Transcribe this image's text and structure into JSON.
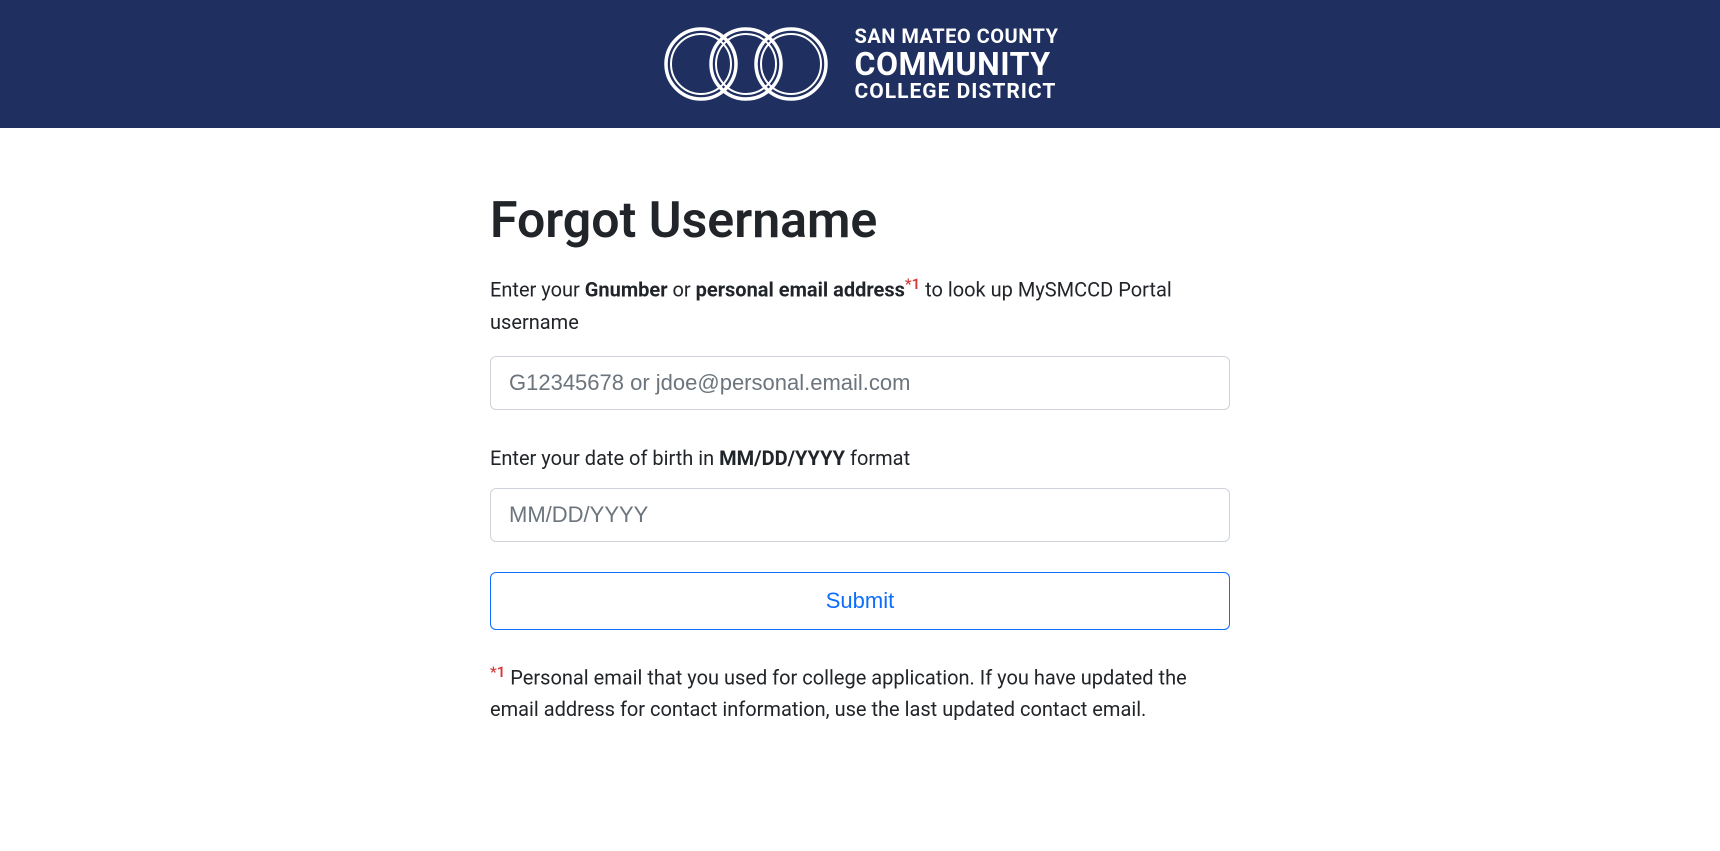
{
  "header": {
    "logo_line1": "SAN MATEO COUNTY",
    "logo_line2": "COMMUNITY",
    "logo_line3": "COLLEGE DISTRICT"
  },
  "page": {
    "title": "Forgot Username",
    "instruction_pre": "Enter your ",
    "instruction_bold1": "Gnumber",
    "instruction_mid": " or ",
    "instruction_bold2": "personal email address",
    "instruction_marker": "*1",
    "instruction_post": " to look up MySMCCD Portal username",
    "identifier_placeholder": "G12345678 or jdoe@personal.email.com",
    "dob_label_pre": "Enter your date of birth in ",
    "dob_label_bold": "MM/DD/YYYY",
    "dob_label_post": " format",
    "dob_placeholder": "MM/DD/YYYY",
    "submit_label": "Submit",
    "footnote_marker": "*1",
    "footnote_text": " Personal email that you used for college application. If you have updated the email address for contact information, use the last updated contact email."
  }
}
